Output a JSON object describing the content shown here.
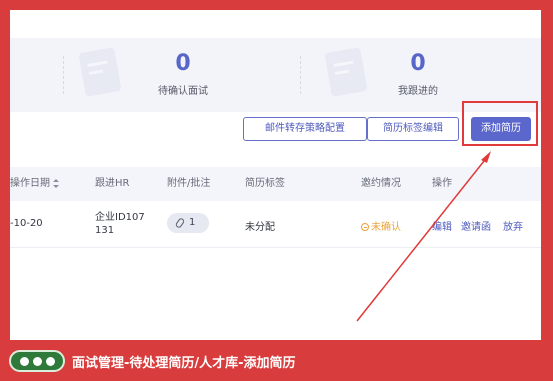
{
  "stats": [
    {
      "value": "0",
      "label": "待确认面试"
    },
    {
      "value": "0",
      "label": "我跟进的"
    }
  ],
  "toolbar": {
    "mail_strategy_label": "邮件转存策略配置",
    "tag_edit_label": "简历标签编辑",
    "add_resume_label": "添加简历"
  },
  "table": {
    "headers": {
      "date": "操作日期",
      "hr": "跟进HR",
      "attachment": "附件/批注",
      "tags": "简历标签",
      "invite": "邀约情况",
      "actions": "操作"
    },
    "row": {
      "date": "-10-20",
      "hr_line1": "企业ID107",
      "hr_line2": "131",
      "attachment_count": "1",
      "tag": "未分配",
      "status": "未确认",
      "edit": "编辑",
      "invite_letter": "邀请函",
      "discard": "放弃"
    }
  },
  "footer": {
    "title": "面试管理-待处理简历/人才库-添加简历"
  },
  "colors": {
    "frame": "#d83c3c",
    "accent": "#5b67cc",
    "status_pending": "#e8a33c"
  }
}
